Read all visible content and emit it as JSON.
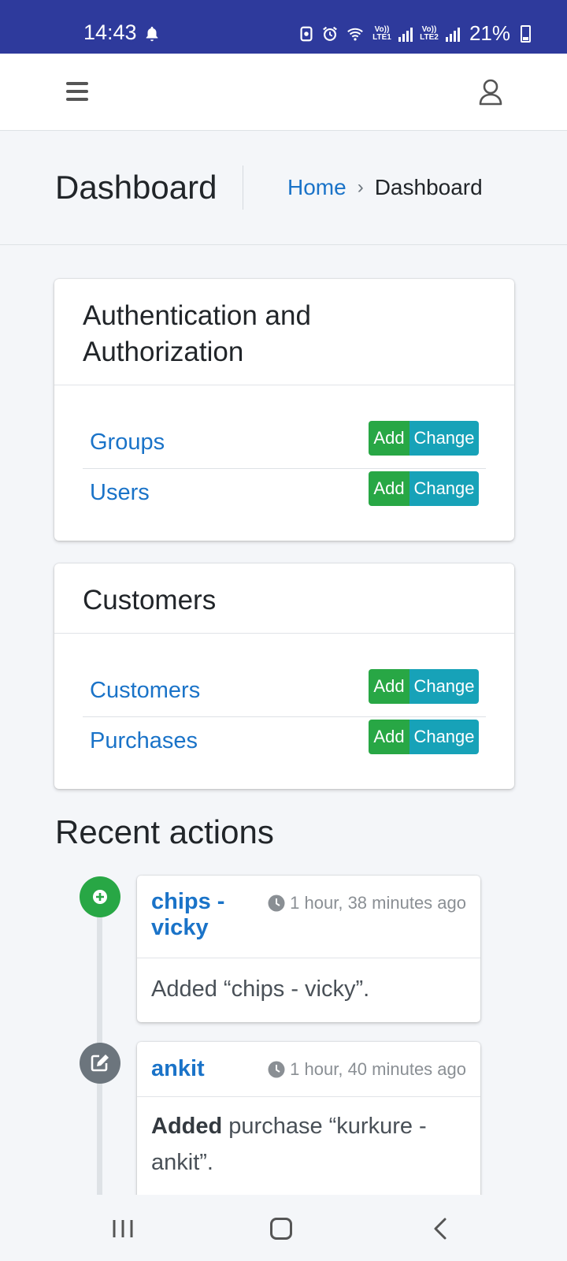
{
  "status_bar": {
    "time": "14:43",
    "battery": "21%",
    "net1": "Vo)) LTE1",
    "net2": "Vo)) LTE2"
  },
  "navbar": {
    "menu_icon": "hamburger-icon",
    "user_icon": "user-icon"
  },
  "header": {
    "title": "Dashboard",
    "breadcrumb": [
      {
        "label": "Home"
      },
      {
        "label": "Dashboard"
      }
    ],
    "separator": "›"
  },
  "apps": [
    {
      "name": "Authentication and Authorization",
      "models": [
        {
          "label": "Groups",
          "add": "Add",
          "change": "Change"
        },
        {
          "label": "Users",
          "add": "Add",
          "change": "Change"
        }
      ]
    },
    {
      "name": "Customers",
      "models": [
        {
          "label": "Customers",
          "add": "Add",
          "change": "Change"
        },
        {
          "label": "Purchases",
          "add": "Add",
          "change": "Change"
        }
      ]
    }
  ],
  "recent_actions": {
    "title": "Recent actions",
    "items": [
      {
        "object": "chips - vicky",
        "object_line1": "chips -",
        "object_line2": "vicky",
        "time": "1 hour, 38 minutes ago",
        "description": "Added “chips - vicky”.",
        "icon": "plus-icon",
        "color": "#28a745"
      },
      {
        "object": "ankit",
        "time": "1 hour, 40 minutes ago",
        "action_word": "Added",
        "description_rest": " purchase “kurkure - ankit”.",
        "icon": "edit-icon",
        "color": "#6c757d"
      }
    ]
  },
  "colors": {
    "status_bar": "#2e3a9c",
    "link": "#1a73c8",
    "add_button": "#28a745",
    "change_button": "#17a2b8"
  }
}
